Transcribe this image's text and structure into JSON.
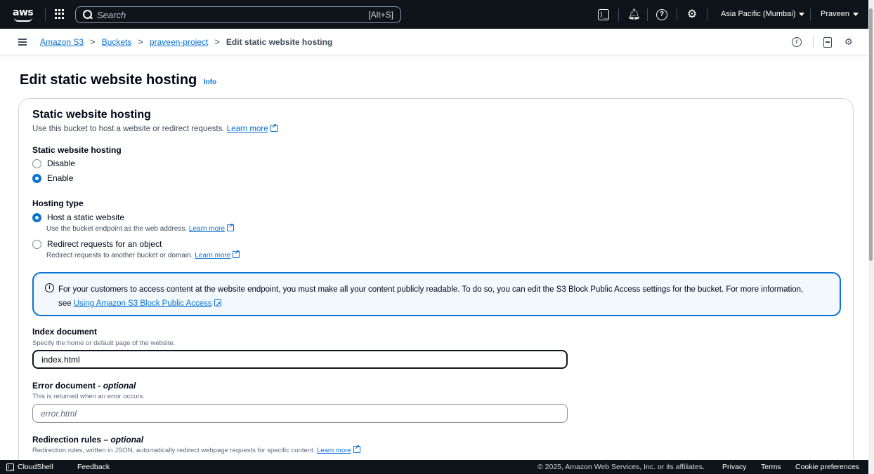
{
  "topnav": {
    "logo_text": "aws",
    "search_placeholder": "Search",
    "search_shortcut": "[Alt+S]",
    "cloudshell_glyph": "⟩_",
    "help_glyph": "?",
    "region": "Asia Pacific (Mumbai)",
    "user": "Praveen"
  },
  "breadcrumb": {
    "items": [
      "Amazon S3",
      "Buckets",
      "praveen-project"
    ],
    "current": "Edit static website hosting",
    "separator": ">",
    "info_glyph": "i"
  },
  "page": {
    "title": "Edit static website hosting",
    "info_link": "Info"
  },
  "section": {
    "title": "Static website hosting",
    "description": "Use this bucket to host a website or redirect requests.",
    "learn_more": "Learn more"
  },
  "hosting_toggle": {
    "label": "Static website hosting",
    "options": [
      "Disable",
      "Enable"
    ],
    "selected": "Enable"
  },
  "hosting_type": {
    "label": "Hosting type",
    "options": [
      {
        "label": "Host a static website",
        "description": "Use the bucket endpoint as the web address.",
        "link": "Learn more",
        "selected": true
      },
      {
        "label": "Redirect requests for an object",
        "description": "Redirect requests to another bucket or domain.",
        "link": "Learn more",
        "selected": false
      }
    ]
  },
  "alert": {
    "text": "For your customers to access content at the website endpoint, you must make all your content publicly readable. To do so, you can edit the S3 Block Public Access settings for the bucket. For more information, see",
    "link": "Using Amazon S3 Block Public Access"
  },
  "index_document": {
    "label": "Index document",
    "description": "Specify the home or default page of the website.",
    "value": "index.html"
  },
  "error_document": {
    "label": "Error document",
    "optional": "- optional",
    "description": "This is returned when an error occurs.",
    "placeholder": "error.html",
    "value": ""
  },
  "redirection_rules": {
    "label": "Redirection rules",
    "optional": "– optional",
    "description": "Redirection rules, written in JSON, automatically redirect webpage requests for specific content.",
    "link": "Learn more"
  },
  "footer": {
    "cloudshell": "CloudShell",
    "feedback": "Feedback",
    "copyright": "© 2025, Amazon Web Services, Inc. or its affiliates.",
    "privacy": "Privacy",
    "terms": "Terms",
    "cookie": "Cookie preferences"
  },
  "colors": {
    "nav_bg": "#0f141a",
    "link": "#0972d3",
    "alert_bg": "#f2f8fd"
  }
}
